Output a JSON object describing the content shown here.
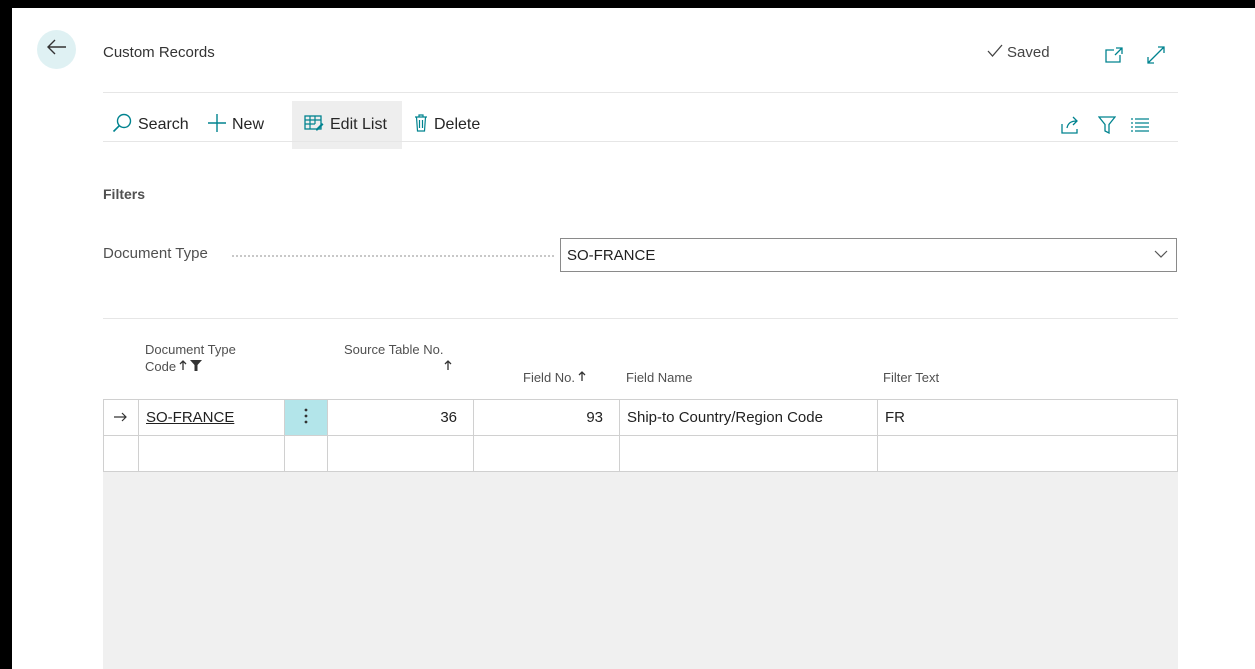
{
  "header": {
    "title": "Custom Records",
    "saved_label": "Saved"
  },
  "actions": {
    "search": "Search",
    "new": "New",
    "edit_list": "Edit List",
    "delete": "Delete"
  },
  "filters": {
    "title": "Filters",
    "document_type_label": "Document Type",
    "document_type_value": "SO-FRANCE"
  },
  "columns": {
    "doc_type_code_line1": "Document Type",
    "doc_type_code_line2": "Code",
    "source_table_line1": "Source Table No.",
    "field_no": "Field No.",
    "field_name": "Field Name",
    "filter_text": "Filter Text"
  },
  "rows": [
    {
      "document_type_code": "SO-FRANCE",
      "source_table_no": "36",
      "field_no": "93",
      "field_name": "Ship-to Country/Region Code",
      "filter_text": "FR"
    }
  ],
  "icons": {
    "back": "back-arrow-icon",
    "saved": "checkmark-icon",
    "open_new": "open-in-new-window-icon",
    "expand": "expand-icon",
    "search": "search-icon",
    "new": "plus-icon",
    "edit_list": "edit-list-icon",
    "delete": "trash-icon",
    "share": "share-icon",
    "filter": "filter-icon",
    "list_view": "list-view-icon"
  },
  "colors": {
    "accent": "#00838f",
    "back_button_bg": "#dff1f3",
    "row_action_bg": "#b3e5ea"
  }
}
